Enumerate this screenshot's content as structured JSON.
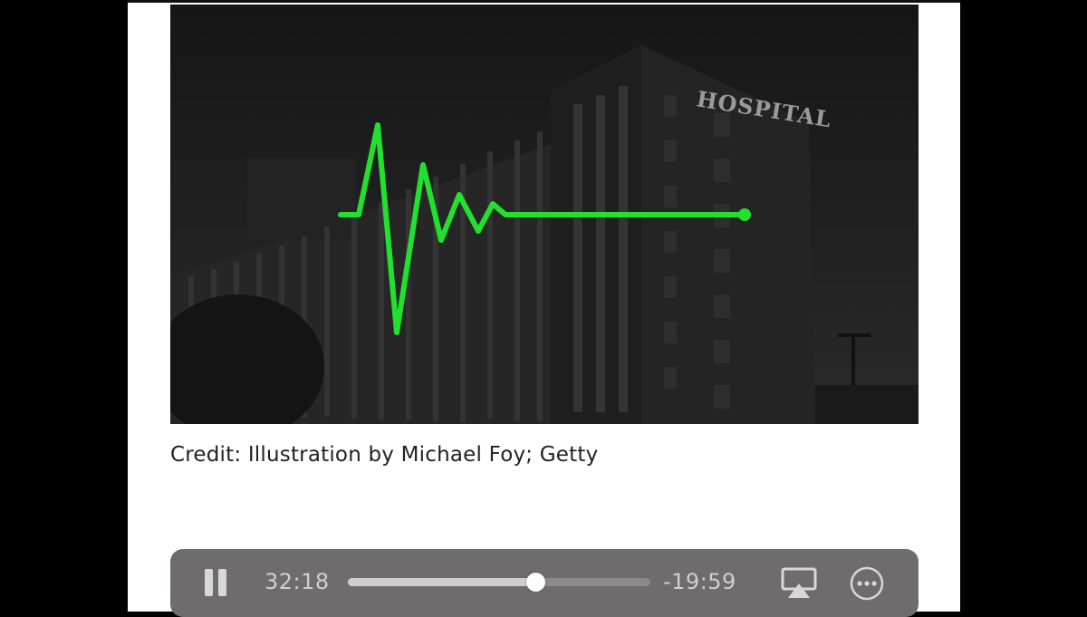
{
  "article": {
    "image": {
      "sign_text": "HOSPITAL",
      "heartbeat_color": "#22e02e",
      "icon": "hospital-heartbeat-illustration"
    },
    "caption": "Credit: Illustration by Michael Foy; Getty"
  },
  "player": {
    "state": "playing",
    "elapsed": "32:18",
    "remaining": "-19:59",
    "progress_fraction": 0.62,
    "icons": {
      "play_pause": "pause-icon",
      "airplay": "airplay-icon",
      "more": "more-options-icon"
    }
  }
}
